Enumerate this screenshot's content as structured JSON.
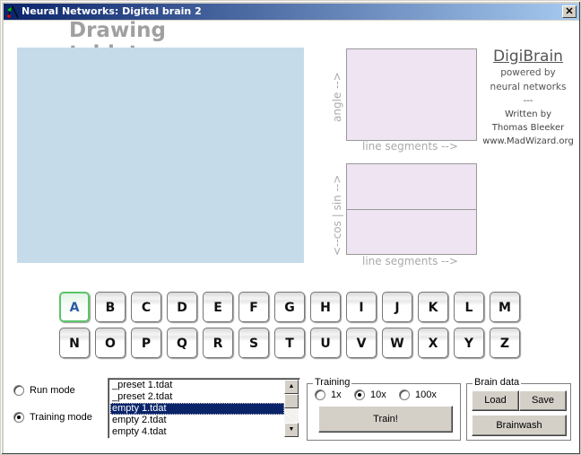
{
  "window": {
    "title": "Neural Networks: Digital brain 2",
    "close_glyph": "✕"
  },
  "heading": "Drawing tablet",
  "plots": {
    "angle_plot": {
      "y_label": "angle -->",
      "x_label": "line segments -->"
    },
    "sincos_plot": {
      "y_label": "<--cos | sin -->",
      "x_label": "line segments -->"
    }
  },
  "brand": {
    "name": "DigiBrain",
    "line1": "powered by",
    "line2": "neural networks",
    "separator": "---",
    "line3": "Written by",
    "author": "Thomas Bleeker",
    "website": "www.MadWizard.org"
  },
  "letters": {
    "row1": [
      "A",
      "B",
      "C",
      "D",
      "E",
      "F",
      "G",
      "H",
      "I",
      "J",
      "K",
      "L",
      "M"
    ],
    "row2": [
      "N",
      "O",
      "P",
      "Q",
      "R",
      "S",
      "T",
      "U",
      "V",
      "W",
      "X",
      "Y",
      "Z"
    ],
    "active": "A"
  },
  "modes": {
    "run_label": "Run mode",
    "training_label": "Training mode",
    "selected": "training"
  },
  "file_list": {
    "items": [
      "_preset 1.tdat",
      "_preset 2.tdat",
      "empty 1.tdat",
      "empty 2.tdat",
      "empty 4.tdat"
    ],
    "selected_index": 2,
    "up_glyph": "▲",
    "down_glyph": "▼"
  },
  "training": {
    "group_label": "Training",
    "options": [
      "1x",
      "10x",
      "100x"
    ],
    "selected": "10x",
    "train_button": "Train!"
  },
  "brain_data": {
    "group_label": "Brain data",
    "load_button": "Load",
    "save_button": "Save",
    "brainwash_button": "Brainwash"
  }
}
